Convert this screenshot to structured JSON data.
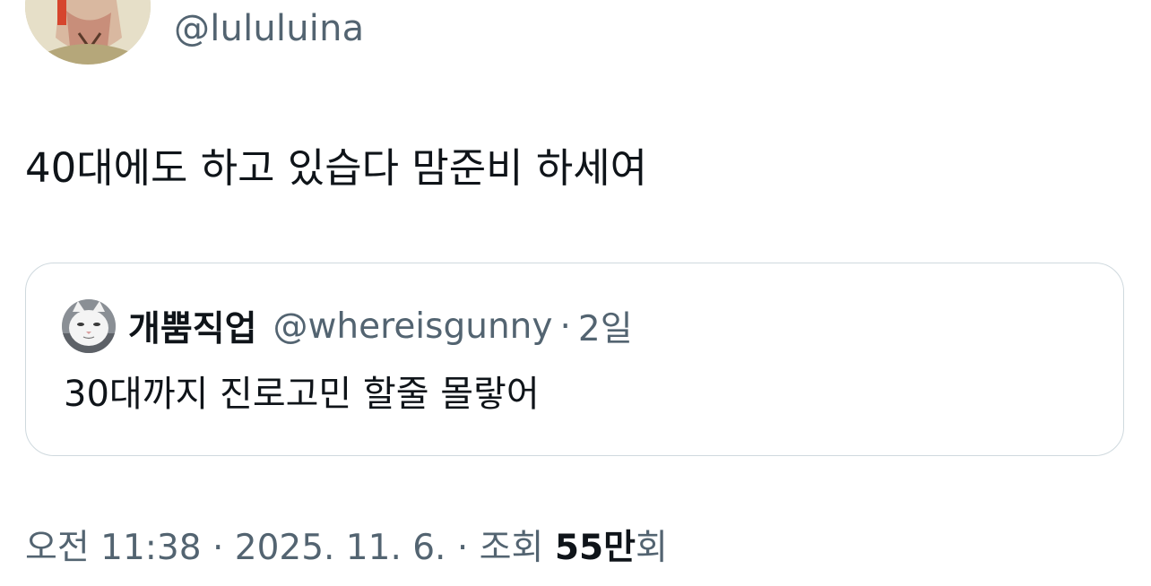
{
  "author": {
    "handle": "@lululuina"
  },
  "tweet": {
    "text": "40대에도 하고 있습다 맘준비 하세여"
  },
  "quoted_tweet": {
    "display_name": "개뿜직업",
    "handle": "@whereisgunny",
    "separator": "·",
    "time": "2일",
    "text": "30대까지 진로고민 할줄 몰랗어"
  },
  "meta": {
    "time": "오전 11:38",
    "sep1": " · ",
    "date": "2025. 11. 6.",
    "sep2": " · ",
    "views_label": "조회 ",
    "views_count": "55만",
    "views_unit": "회"
  },
  "colors": {
    "text_primary": "#0f1419",
    "text_secondary": "#536471",
    "border": "#cfd9de"
  }
}
